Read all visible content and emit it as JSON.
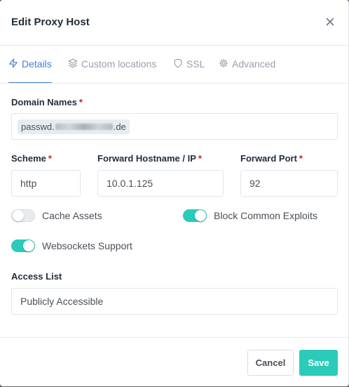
{
  "modal": {
    "title": "Edit Proxy Host",
    "close_icon": "close-icon"
  },
  "tabs": [
    {
      "label": "Details",
      "icon": "lightning-icon",
      "active": true
    },
    {
      "label": "Custom locations",
      "icon": "layers-icon",
      "active": false
    },
    {
      "label": "SSL",
      "icon": "shield-icon",
      "active": false
    },
    {
      "label": "Advanced",
      "icon": "gear-icon",
      "active": false
    }
  ],
  "form": {
    "domain_names_label": "Domain Names",
    "required_mark": "*",
    "domain_chip_prefix": "passwd.",
    "domain_chip_suffix": ".de",
    "scheme_label": "Scheme",
    "scheme_value": "http",
    "hostname_label": "Forward Hostname / IP",
    "hostname_value": "10.0.1.125",
    "port_label": "Forward Port",
    "port_value": "92",
    "cache_assets_label": "Cache Assets",
    "cache_assets_on": false,
    "block_exploits_label": "Block Common Exploits",
    "block_exploits_on": true,
    "websockets_label": "Websockets Support",
    "websockets_on": true,
    "access_list_label": "Access List",
    "access_list_value": "Publicly Accessible"
  },
  "footer": {
    "cancel_label": "Cancel",
    "save_label": "Save"
  },
  "colors": {
    "accent": "#467fcf",
    "toggle_on": "#2bcbba",
    "required": "#cd201f",
    "save_button": "#2bcbba"
  }
}
